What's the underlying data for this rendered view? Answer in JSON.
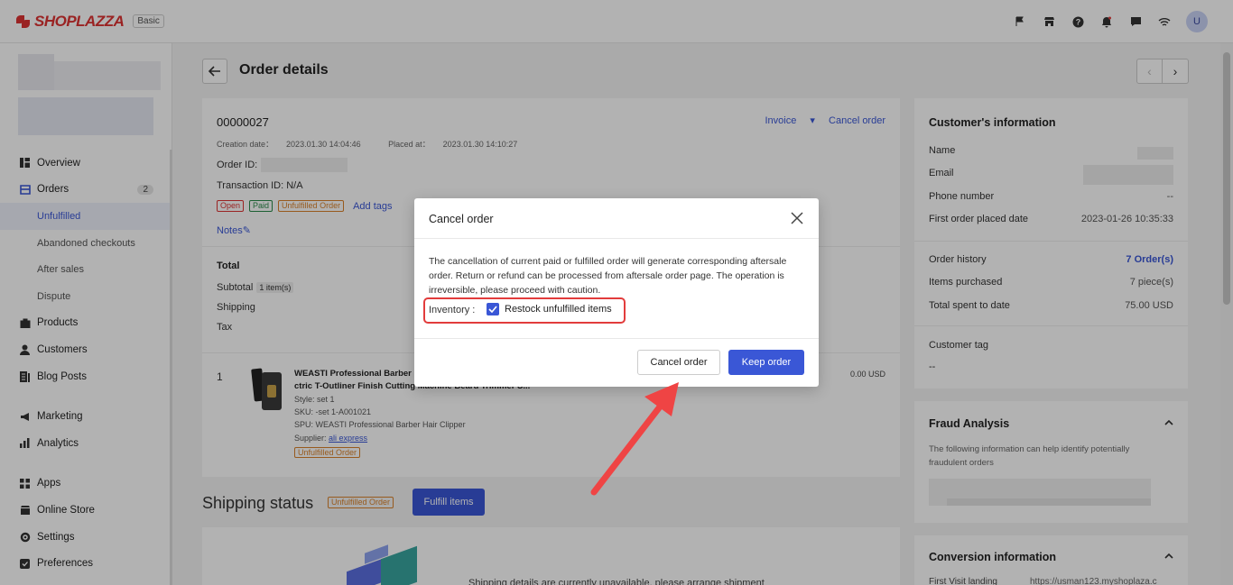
{
  "topbar": {
    "brand": "SHOPLAZZA",
    "plan": "Basic",
    "avatar_initial": "U",
    "icons": [
      "flag-icon",
      "store-icon",
      "help-icon",
      "bell-icon",
      "chat-icon",
      "wifi-icon"
    ]
  },
  "sidebar": {
    "items": [
      {
        "label": "Overview",
        "icon": "overview-icon"
      },
      {
        "label": "Orders",
        "icon": "orders-icon",
        "badge": "2"
      },
      {
        "label": "Unfulfilled"
      },
      {
        "label": "Abandoned checkouts"
      },
      {
        "label": "After sales"
      },
      {
        "label": "Dispute"
      },
      {
        "label": "Products",
        "icon": "products-icon"
      },
      {
        "label": "Customers",
        "icon": "customers-icon"
      },
      {
        "label": "Blog Posts",
        "icon": "blog-icon"
      },
      {
        "label": "Marketing",
        "icon": "marketing-icon"
      },
      {
        "label": "Analytics",
        "icon": "analytics-icon"
      },
      {
        "label": "Apps",
        "icon": "apps-icon"
      },
      {
        "label": "Online Store",
        "icon": "online-store-icon"
      },
      {
        "label": "Settings",
        "icon": "settings-icon"
      },
      {
        "label": "Preferences",
        "icon": "preferences-icon"
      }
    ]
  },
  "page": {
    "title": "Order details"
  },
  "order": {
    "number": "00000027",
    "creation_label": "Creation date：",
    "creation_date": "2023.01.30 14:04:46",
    "placed_label": "Placed at：",
    "placed_at": "2023.01.30 14:10:27",
    "invoice": "Invoice",
    "cancel_order": "Cancel order",
    "order_id_label": "Order ID:",
    "transaction_id": "Transaction ID: N/A",
    "tags": {
      "open": "Open",
      "paid": "Paid",
      "unfulfilled": "Unfulfilled Order"
    },
    "add_tags": "Add tags",
    "notes": "Notes",
    "total": "Total",
    "subtotal": "Subtotal",
    "subtotal_qty": "1 item(s)",
    "shipping": "Shipping",
    "tax": "Tax"
  },
  "item": {
    "index": "1",
    "title_line1": "WEASTI Professional Barber H",
    "title_line2": "ctric T-Outliner Finish Cutting Machine Beard Trimmer S...",
    "style": "Style: set 1",
    "sku": "SKU: -set 1-A001021",
    "spu": "SPU: WEASTI Professional Barber Hair Clipper",
    "supplier_label": "Supplier: ",
    "supplier": "ali express",
    "status": "Unfulfilled Order",
    "price": "0.00 USD"
  },
  "shipping": {
    "title": "Shipping status",
    "tag": "Unfulfilled Order",
    "fulfill_button": "Fulfill items",
    "message": "Shipping details are currently unavailable, please arrange shipment"
  },
  "customer": {
    "title": "Customer's information",
    "name_label": "Name",
    "email_label": "Email",
    "phone_label": "Phone number",
    "phone": "--",
    "first_order_label": "First order placed date",
    "first_order": "2023-01-26 10:35:33",
    "history_label": "Order history",
    "history": "7 Order(s)",
    "items_label": "Items purchased",
    "items": "7 piece(s)",
    "spent_label": "Total spent to date",
    "spent": "75.00 USD",
    "tag_label": "Customer tag",
    "tag": "--"
  },
  "fraud": {
    "title": "Fraud Analysis",
    "desc": "The following information can help identify potentially fraudulent orders"
  },
  "conversion": {
    "title": "Conversion information",
    "row_label": "First Visit landing",
    "row_value": "https://usman123.myshoplaza.c"
  },
  "modal": {
    "title": "Cancel order",
    "message": "The cancellation of current paid or fulfilled order will generate corresponding aftersale order. Return or refund can be processed from aftersale order page. The operation is irreversible, please proceed with caution.",
    "inventory_label": "Inventory :",
    "restock_label": "Restock unfulfilled items",
    "restock_checked": true,
    "cancel_button": "Cancel order",
    "keep_button": "Keep order"
  },
  "colors": {
    "primary": "#3a57d6",
    "highlight": "#e23c3c",
    "danger_tag": "#d33",
    "paid_tag": "#2a8a4a",
    "unfulfilled_tag": "#d9822b"
  }
}
